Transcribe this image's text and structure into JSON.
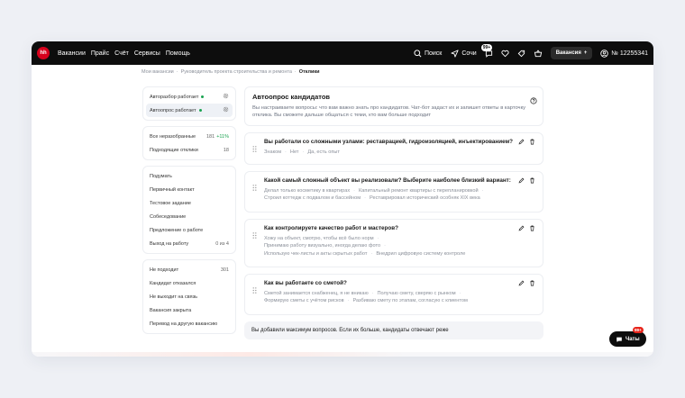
{
  "header": {
    "logo": "hh",
    "nav": [
      "Вакансии",
      "Прайс",
      "Счёт",
      "Сервисы",
      "Помощь"
    ],
    "search_label": "Поиск",
    "city_label": "Сочи",
    "notif_badge": "99+",
    "vacancies_button": "Вакансия",
    "account_id": "№ 12255341",
    "colors": {
      "bg": "#0d0d0d",
      "brand": "#d6001c"
    }
  },
  "breadcrumb": [
    "Мои вакансии",
    "Руководитель проекта строительства и ремонта",
    "Отклики"
  ],
  "sidebar": {
    "auto_group": [
      {
        "label": "Авторазбор работает"
      },
      {
        "label": "Автоопрос работает"
      }
    ],
    "counts": [
      {
        "label": "Все неразобранные",
        "value": "181",
        "delta": "+11%"
      },
      {
        "label": "Подходящие отклики",
        "value": "18"
      }
    ],
    "stages": [
      {
        "label": "Подумать",
        "value": ""
      },
      {
        "label": "Первичный контакт",
        "value": ""
      },
      {
        "label": "Тестовое задание",
        "value": ""
      },
      {
        "label": "Собеседование",
        "value": ""
      },
      {
        "label": "Предложение о работе",
        "value": ""
      },
      {
        "label": "Выход на работу",
        "value": "0 из 4"
      }
    ],
    "rejects": [
      {
        "label": "Не подходит",
        "value": "301"
      },
      {
        "label": "Кандидат отказался",
        "value": ""
      },
      {
        "label": "Не выходит на связь",
        "value": ""
      },
      {
        "label": "Вакансия закрыта",
        "value": ""
      },
      {
        "label": "Перевод на другую вакансию",
        "value": ""
      }
    ]
  },
  "main": {
    "title": "Автоопрос кандидатов",
    "description": "Вы настраиваете вопросы: что вам важно знать про кандидатов. Чат-бот задаст их и запишет ответы в карточку отклика. Вы сможете дальше общаться с теми, кто вам больше подходит",
    "questions": [
      {
        "title": "Вы работали со сложными узлами: реставрацией, гидроизоляцией, инъектированием?",
        "answers_line1": [
          "Знаком",
          "Нет",
          "Да, есть опыт"
        ],
        "answers_line2": []
      },
      {
        "title": "Какой самый сложный объект вы реализовали? Выберите наиболее близкий вариант:",
        "answers_line1": [
          "Делал только косметику в квартирах",
          "Капитальный ремонт квартиры с перепланировкой"
        ],
        "answers_line2": [
          "Строил коттедж с подвалом и бассейном",
          "Реставрировал исторический особняк XIX века"
        ]
      },
      {
        "title": "Как контролируете качество работ и мастеров?",
        "answers_line1": [
          "Хожу на объект, смотрю, чтобы всё было норм"
        ],
        "answers_line2": [
          "Принимаю работу визуально, иногда делаю фото"
        ],
        "answers_line3": [
          "Использую чек-листы и акты скрытых работ",
          "Внедрил цифровую систему контроле"
        ]
      },
      {
        "title": "Как вы работаете со сметой?",
        "answers_line1": [
          "Сметой занимается снабженец, я не вникаю",
          "Получаю смету, сверяю с рынком"
        ],
        "answers_line2": [
          "Формирую сметы с учётом рисков",
          "Разбиваю смету по этапам, согласую с клиентом"
        ]
      }
    ],
    "limit_message": "Вы добавили максимум вопросов. Если их больше, кандидаты отвечают реже"
  },
  "chats": {
    "label": "Чаты",
    "badge": "99+"
  }
}
